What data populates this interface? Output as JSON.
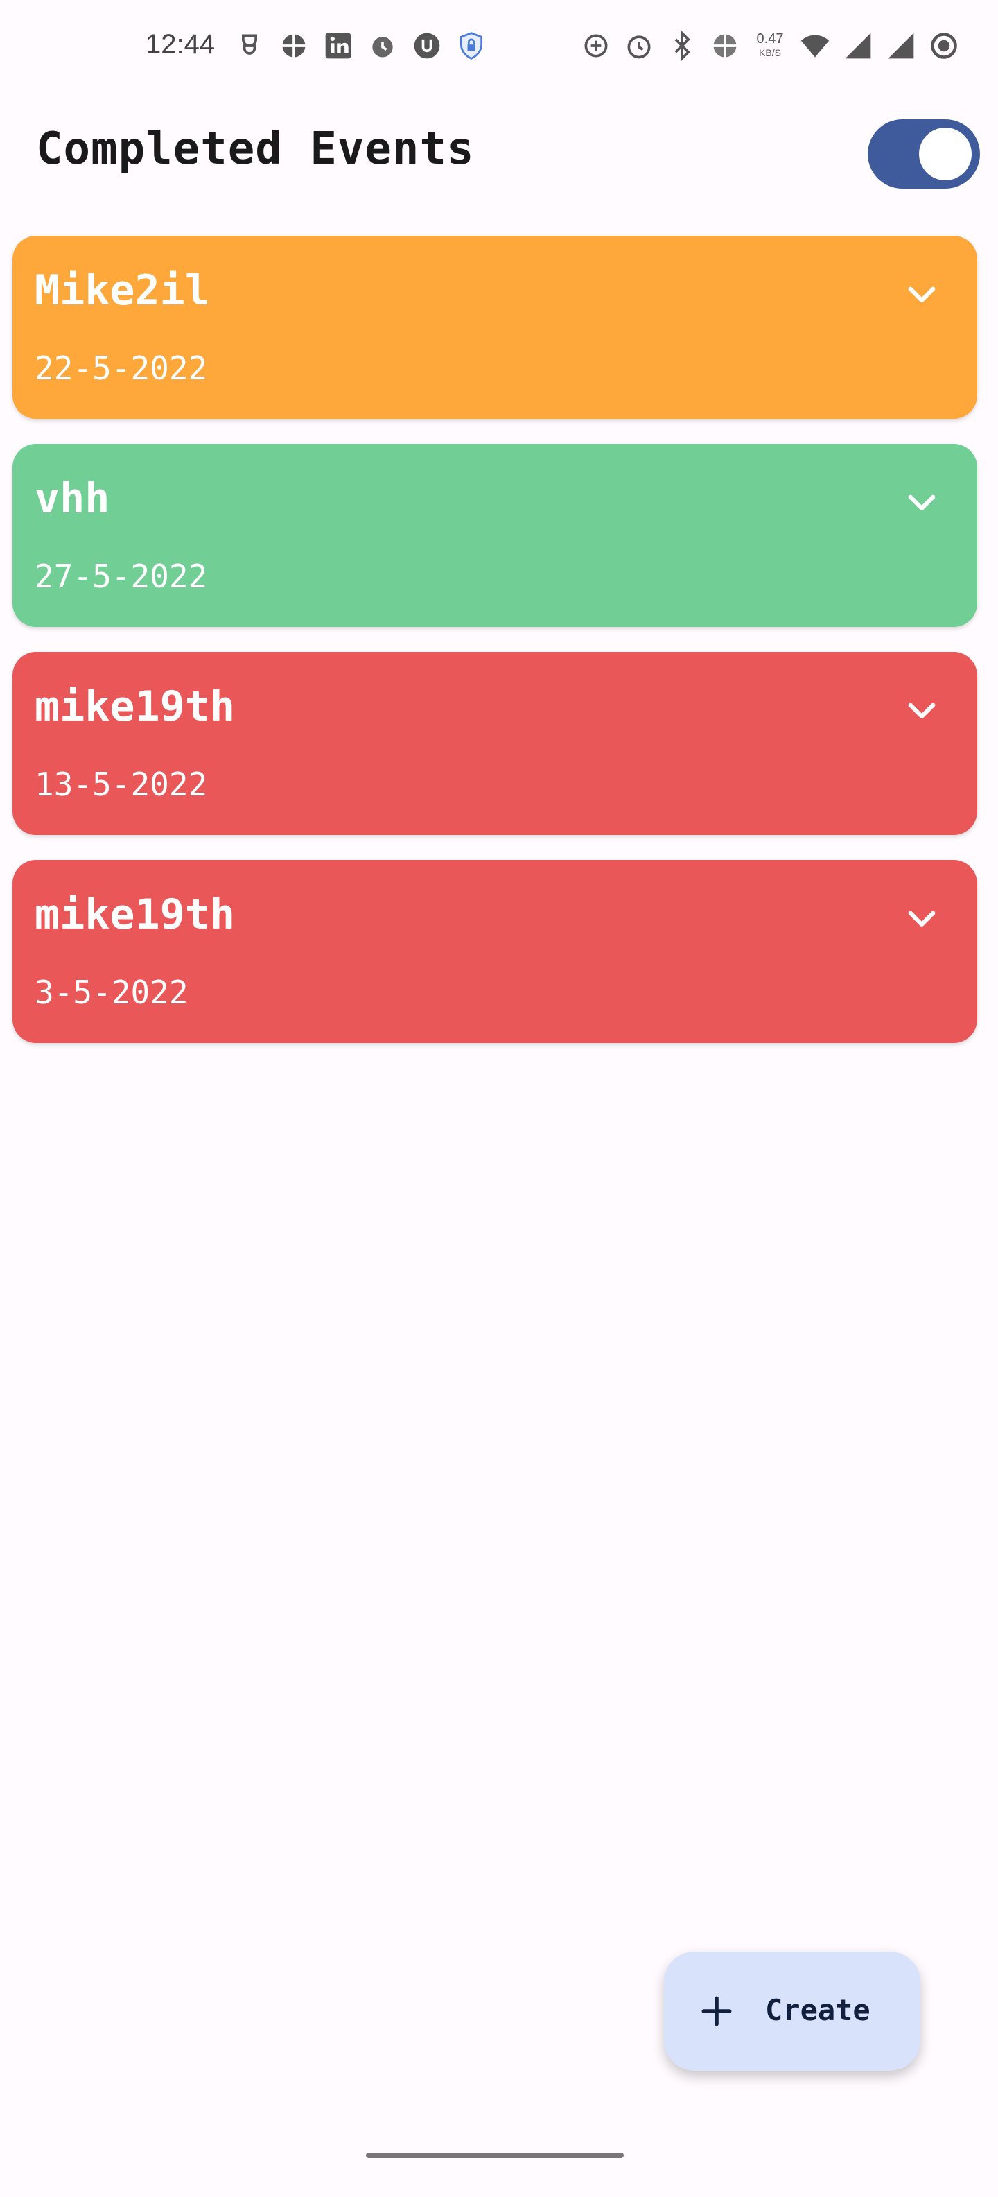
{
  "status_bar": {
    "time": "12:44",
    "left_icons": [
      "mask-icon",
      "vpn-globe-icon",
      "linkedin-icon",
      "alarm-icon",
      "shield-u-icon",
      "lock-shield-icon"
    ],
    "right_icons": [
      "data-saver-icon",
      "alarm-icon",
      "bluetooth-icon",
      "globe-icon"
    ],
    "net_speed_value": "0.47",
    "net_speed_unit": "KB/S",
    "end_icons": [
      "wifi-icon",
      "signal-icon",
      "signal-icon",
      "record-icon"
    ]
  },
  "header": {
    "title": "Completed Events",
    "toggle_on": true,
    "toggle_color": "#3f5b9c"
  },
  "events": [
    {
      "title": "Mike2il",
      "date": "22-5-2022",
      "color": "#fea73b"
    },
    {
      "title": "vhh",
      "date": "27-5-2022",
      "color": "#71cf96"
    },
    {
      "title": "mike19th",
      "date": "13-5-2022",
      "color": "#ea5759"
    },
    {
      "title": "mike19th",
      "date": "3-5-2022",
      "color": "#ea5759"
    }
  ],
  "fab": {
    "label": "Create",
    "icon": "plus-icon"
  }
}
